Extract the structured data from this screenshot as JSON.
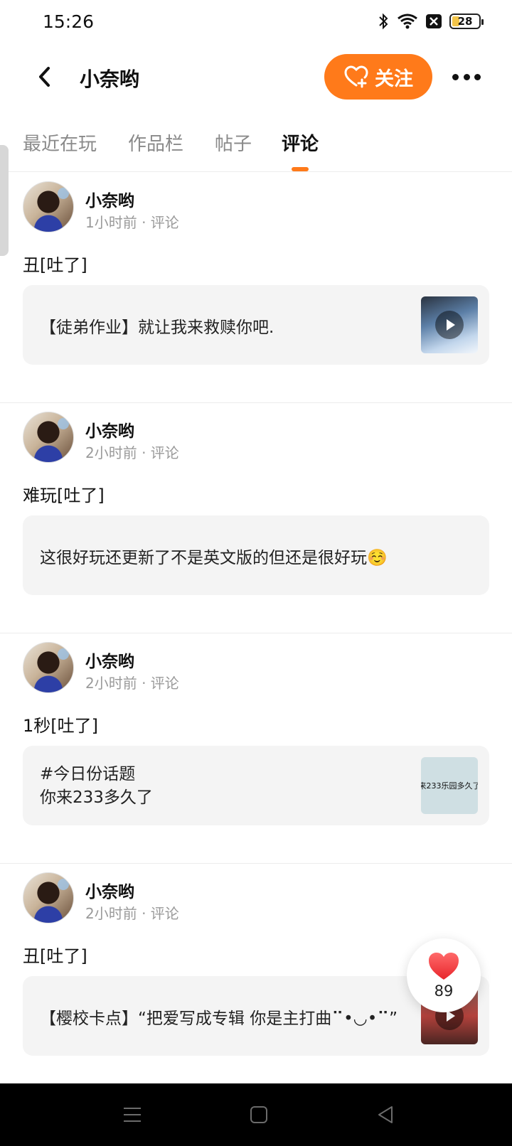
{
  "status_bar": {
    "time": "15:26",
    "battery": "28",
    "icons": [
      "bluetooth-icon",
      "wifi-icon",
      "notification-x-icon",
      "battery-icon"
    ]
  },
  "header": {
    "title": "小奈哟",
    "follow_label": "关注",
    "accent_color": "#ff7a1a"
  },
  "tabs": [
    {
      "label": "最近在玩",
      "active": false
    },
    {
      "label": "作品栏",
      "active": false
    },
    {
      "label": "帖子",
      "active": false
    },
    {
      "label": "评论",
      "active": true
    }
  ],
  "posts": [
    {
      "name": "小奈哟",
      "meta": "1小时前 · 评论",
      "text": "丑[吐了]",
      "quote": "【徒弟作业】就让我来救赎你吧.",
      "thumb": "video"
    },
    {
      "name": "小奈哟",
      "meta": "2小时前 · 评论",
      "text": "难玩[吐了]",
      "quote": "这很好玩还更新了不是英文版的但还是很好玩☺️",
      "thumb": "none"
    },
    {
      "name": "小奈哟",
      "meta": "2小时前 · 评论",
      "text": "1秒[吐了]",
      "quote_line1": "#今日份话题",
      "quote_line2": "你来233多久了",
      "thumb": "text",
      "thumb_text": "来233乐园多久了"
    },
    {
      "name": "小奈哟",
      "meta": "2小时前 · 评论",
      "text": "丑[吐了]",
      "quote": "【樱校卡点】“把爱写成专辑 你是主打曲⠉•◡•⠉”",
      "thumb": "video"
    }
  ],
  "like_fab": {
    "count": "89",
    "icon": "heart-icon"
  },
  "nav_bar": {
    "buttons": [
      "menu-icon",
      "home-icon",
      "back-triangle-icon"
    ]
  }
}
